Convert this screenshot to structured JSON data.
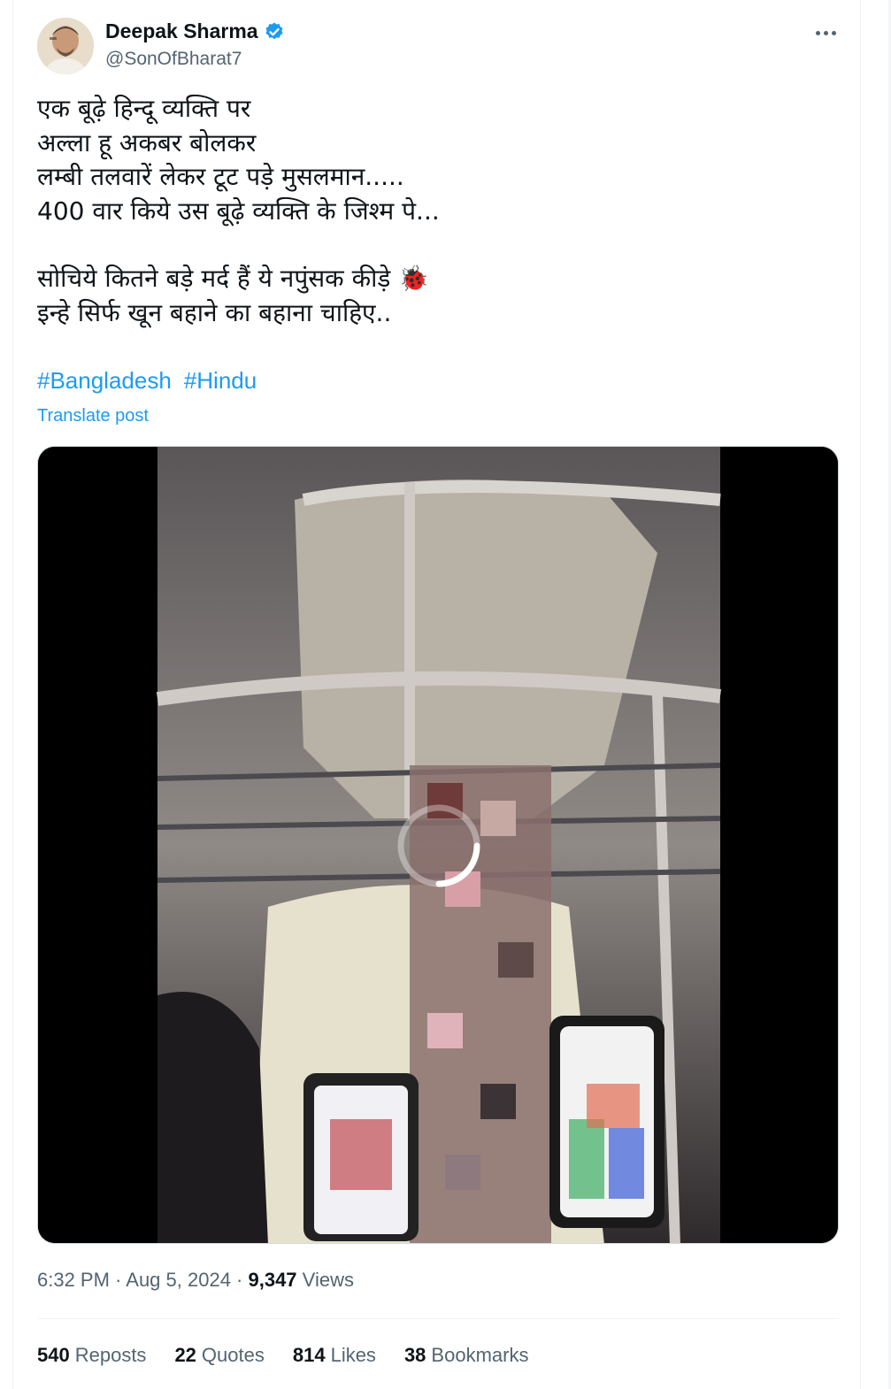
{
  "author": {
    "name": "Deepak Sharma",
    "handle": "@SonOfBharat7",
    "verified_color": "#1d9bf0"
  },
  "post": {
    "lines": [
      "एक बूढ़े हिन्दू व्यक्ति पर",
      "अल्ला हू अकबर बोलकर",
      "लम्बी तलवारें लेकर टूट पड़े मुसलमान.....",
      "400 वार किये उस बूढ़े व्यक्ति के जिश्म पे...",
      "",
      "सोचिये कितने बड़े मर्द हैं ये नपुंसक कीड़े 🐞",
      "इन्हे सिर्फ खून बहाने का बहाना चाहिए.."
    ],
    "hashtags": [
      "#Bangladesh",
      "#Hindu"
    ],
    "translate_label": "Translate post",
    "timestamp": "6:32 PM · Aug 5, 2024 · ",
    "views_count": "9,347",
    "views_label": "Views"
  },
  "stats": [
    {
      "count": "540",
      "label": "Reposts"
    },
    {
      "count": "22",
      "label": "Quotes"
    },
    {
      "count": "814",
      "label": "Likes"
    },
    {
      "count": "38",
      "label": "Bookmarks"
    }
  ],
  "colors": {
    "link": "#1d9bf0",
    "secondary": "#536471",
    "primary": "#0f1419"
  },
  "icons": {
    "verified": "verified-badge-icon",
    "more": "more-horizontal-icon",
    "loading": "loading-spinner-icon"
  }
}
